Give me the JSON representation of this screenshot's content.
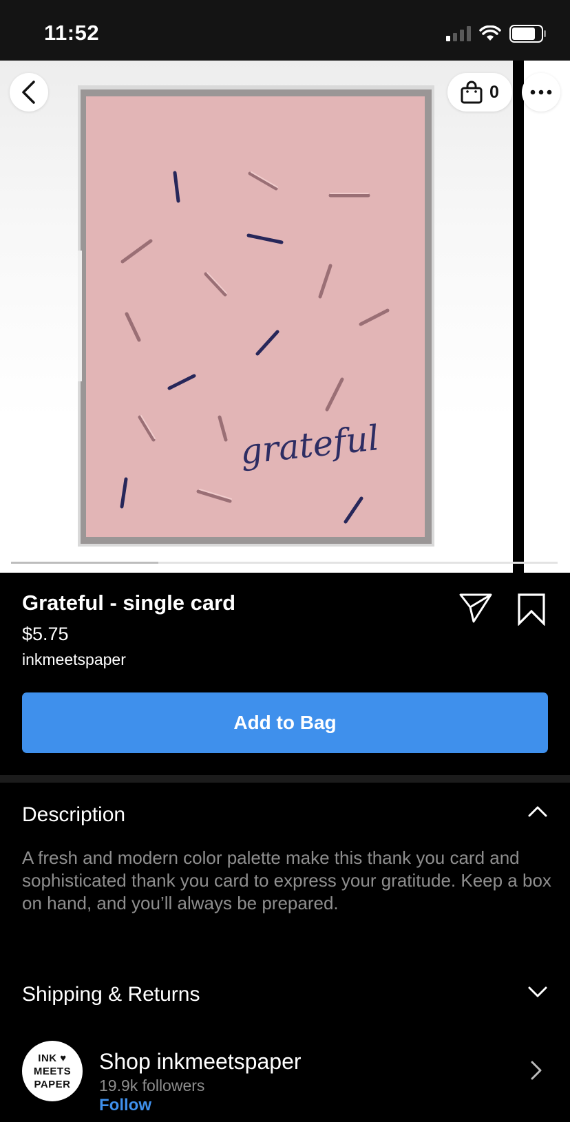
{
  "status_bar": {
    "time": "11:52"
  },
  "header": {
    "bag_count": "0"
  },
  "gallery": {
    "progress": 0.27
  },
  "product": {
    "title": "Grateful - single card",
    "price": "$5.75",
    "seller": "inkmeetspaper",
    "card_script_text": "grateful",
    "add_to_bag_label": "Add to Bag"
  },
  "description": {
    "heading": "Description",
    "text": "A fresh and modern color palette make this thank you card and sophisticated thank you card to express your gratitude. Keep a box on hand, and you’ll always be prepared."
  },
  "shipping": {
    "heading": "Shipping & Returns"
  },
  "shop": {
    "logo_line1": "INK ♥",
    "logo_line2": "MEETS",
    "logo_line3": "PAPER",
    "name": "Shop inkmeetspaper",
    "followers": "19.9k followers",
    "follow_label": "Follow"
  },
  "colors": {
    "accent": "#3f90ec",
    "card_pink": "#e2b5b6",
    "navy": "#27275a"
  },
  "icons": [
    "back-icon",
    "bag-icon",
    "more-icon",
    "share-icon",
    "bookmark-icon",
    "chevron-up-icon",
    "chevron-down-icon",
    "chevron-right-icon"
  ]
}
